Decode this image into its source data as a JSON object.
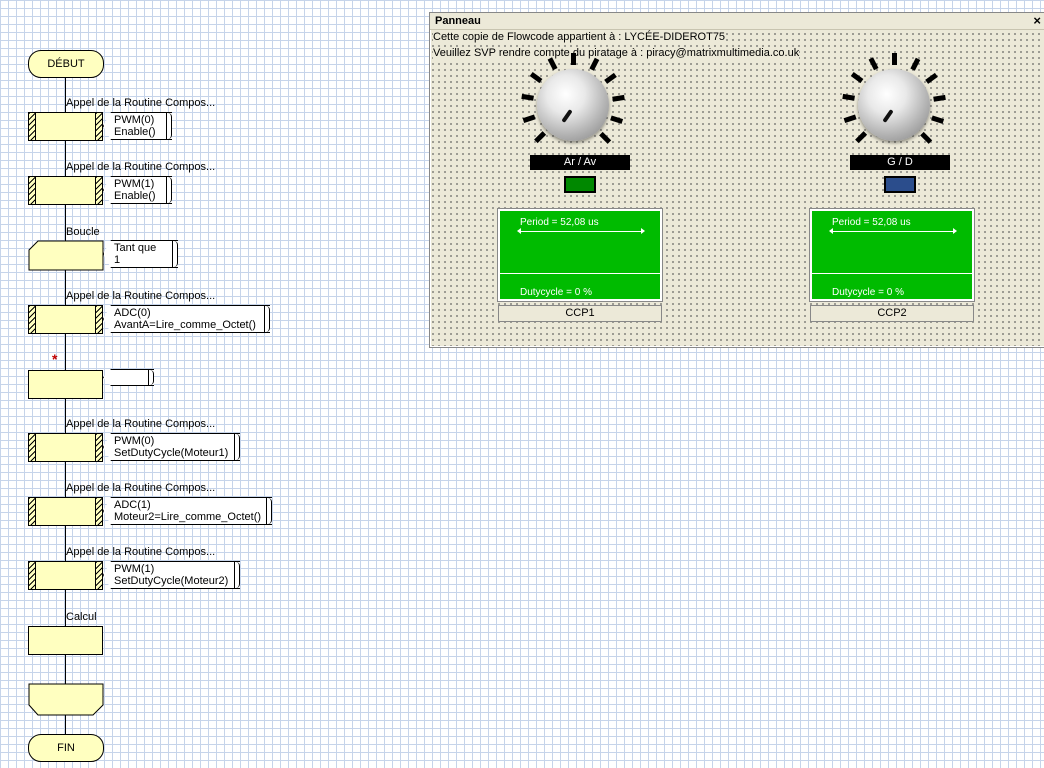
{
  "flowchart": {
    "start": "DÉBUT",
    "end": "FIN",
    "blocks": [
      {
        "label": "Appel de la Routine Compos...",
        "comment": [
          "PWM(0)",
          "Enable()"
        ]
      },
      {
        "label": "Appel de la Routine Compos...",
        "comment": [
          "PWM(1)",
          "Enable()"
        ]
      },
      {
        "label": "Boucle",
        "comment": [
          "Tant que",
          "1"
        ]
      },
      {
        "label": "Appel de la Routine Compos...",
        "comment": [
          "ADC(0)",
          "AvantA=Lire_comme_Octet()"
        ]
      },
      {
        "label": "*",
        "comment": []
      },
      {
        "label": "Appel de la Routine Compos...",
        "comment": [
          "PWM(0)",
          "SetDutyCycle(Moteur1)"
        ]
      },
      {
        "label": "Appel de la Routine Compos...",
        "comment": [
          "ADC(1)",
          "Moteur2=Lire_comme_Octet()"
        ]
      },
      {
        "label": "Appel de la Routine Compos...",
        "comment": [
          "PWM(1)",
          "SetDutyCycle(Moteur2)"
        ]
      },
      {
        "label": "Calcul",
        "comment": []
      }
    ]
  },
  "panel": {
    "title": "Panneau",
    "close": "×",
    "line1": "Cette copie de Flowcode appartient à : LYCÉE-DIDEROT75",
    "line2": "Veuillez SVP rendre compte du piratage à : piracy@matrixmultimedia.co.uk",
    "knobs": [
      {
        "label": "Ar / Av",
        "led_color": "#008800"
      },
      {
        "label": "G / D",
        "led_color": "#2b4d8c"
      }
    ],
    "scopes": [
      {
        "period": "Period =  52,08 us",
        "duty": "Dutycycle =  0 %",
        "name": "CCP1"
      },
      {
        "period": "Period =  52,08 us",
        "duty": "Dutycycle =  0 %",
        "name": "CCP2"
      }
    ]
  }
}
